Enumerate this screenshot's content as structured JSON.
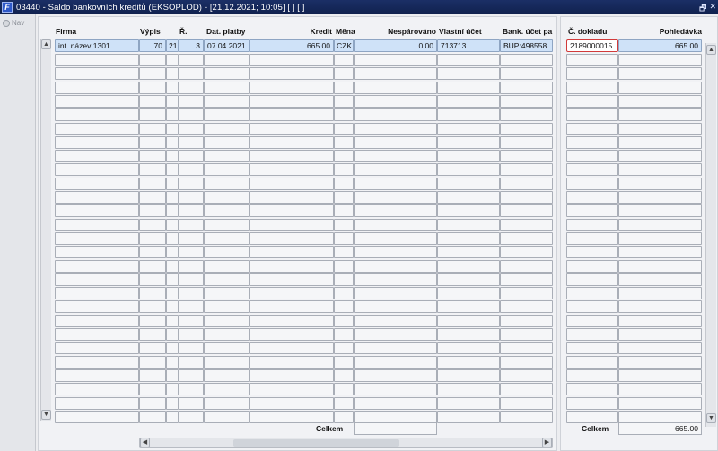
{
  "window": {
    "icon_letter": "F",
    "title": "03440 - Saldo bankovních kreditů (EKSOPLOD) - [21.12.2021; 10:05]  [ ]  [ ]",
    "restore_glyph": "🗗",
    "close_glyph": "✕"
  },
  "side": {
    "nav_label": "Nav"
  },
  "grid": {
    "headers": {
      "firma": "Firma",
      "vypis": "Výpis",
      "r": "Ř.",
      "dat_platby": "Dat. platby",
      "kredit": "Kredit",
      "mena": "Měna",
      "nesparovano": "Nespárováno",
      "vlastni_ucet": "Vlastní účet",
      "bank_ucet": "Bank. účet pa"
    },
    "rows": [
      {
        "firma": "int. název 1301",
        "vypis_a": "70",
        "vypis_b": "21",
        "r": "3",
        "dat_platby": "07.04.2021",
        "kredit": "665.00",
        "mena": "CZK",
        "nesparovano": "0.00",
        "vlastni_ucet": "713713",
        "bank_ucet": "BUP:498558"
      }
    ],
    "empty_rows": 27,
    "footer": {
      "celkem_label": "Celkem",
      "celkem_value": ""
    }
  },
  "right_grid": {
    "headers": {
      "c_dokladu": "Č. dokladu",
      "pohledavka": "Pohledávka"
    },
    "rows": [
      {
        "c_dokladu": "2189000015",
        "pohledavka": "665.00"
      }
    ],
    "footer": {
      "celkem_label": "Celkem",
      "celkem_value": "665.00"
    }
  },
  "scroll": {
    "up": "▲",
    "down": "▼",
    "left": "◀",
    "right": "▶"
  }
}
